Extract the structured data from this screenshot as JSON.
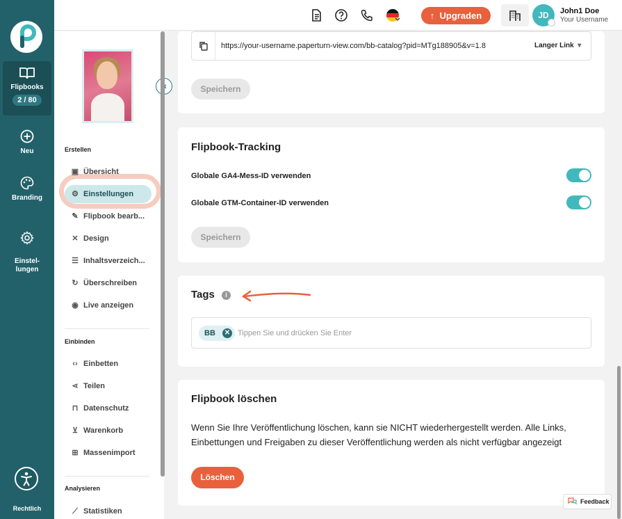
{
  "rail": {
    "items": [
      {
        "label": "Flipbooks",
        "icon": "book-open-icon",
        "badge": "2 / 80"
      },
      {
        "label": "Neu",
        "icon": "plus-circle-icon"
      },
      {
        "label": "Branding",
        "icon": "palette-icon"
      },
      {
        "label": "Einstel-\nlungen",
        "icon": "gear-icon"
      }
    ],
    "footer": "Rechtlich"
  },
  "topbar": {
    "upgrade_label": "Upgraden",
    "avatar_initials": "JD",
    "user_name": "John1 Doe",
    "user_sub": "Your Username"
  },
  "sidebar": {
    "section_create": "Erstellen",
    "section_embed": "Einbinden",
    "section_analyze": "Analysieren",
    "create_items": [
      "Übersicht",
      "Einstellungen",
      "Flipbook bearb...",
      "Design",
      "Inhaltsverzeich...",
      "Überschreiben",
      "Live anzeigen"
    ],
    "embed_items": [
      "Einbetten",
      "Teilen",
      "Datenschutz",
      "Warenkorb",
      "Massenimport"
    ],
    "analyze_items": [
      "Statistiken"
    ]
  },
  "link_card": {
    "url": "https://your-username.paperturn-view.com/bb-catalog?pid=MTg188905&v=1.8",
    "link_type": "Langer Link",
    "save_label": "Speichern"
  },
  "tracking_card": {
    "title": "Flipbook-Tracking",
    "ga4_label": "Globale GA4-Mess-ID verwenden",
    "gtm_label": "Globale GTM-Container-ID verwenden",
    "save_label": "Speichern"
  },
  "tags_card": {
    "title": "Tags",
    "chip": "BB",
    "placeholder": "Tippen Sie und drücken Sie Enter"
  },
  "delete_card": {
    "title": "Flipbook löschen",
    "text": "Wenn Sie Ihre Veröffentlichung löschen, kann sie NICHT wiederhergestellt werden. Alle Links, Einbettungen und Freigaben zu dieser Veröffentlichung werden als nicht verfügbar angezeigt",
    "button": "Löschen"
  },
  "feedback_label": "Feedback",
  "colors": {
    "rail": "#23616a",
    "accent": "#e8603c",
    "teal": "#41b8bd"
  }
}
